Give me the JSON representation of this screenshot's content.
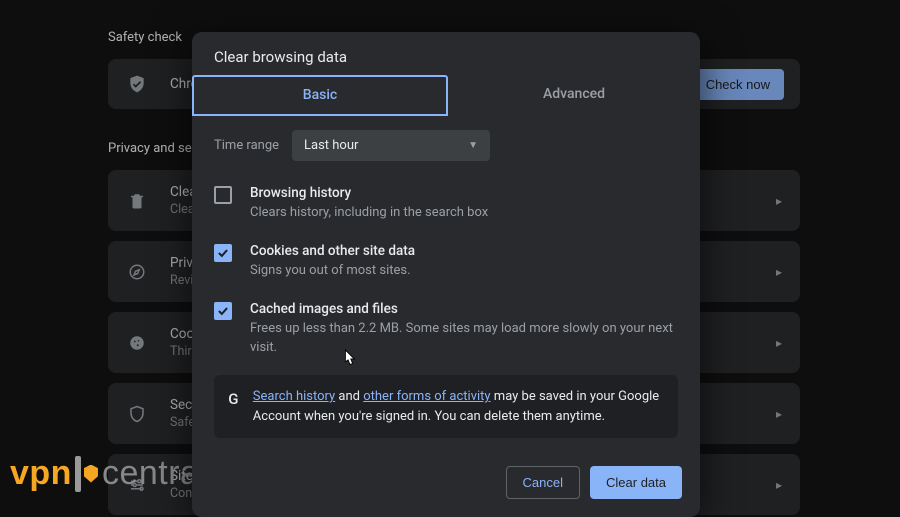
{
  "background": {
    "safety_check_title": "Safety check",
    "chrome_row_title": "Chrome",
    "check_now_label": "Check now",
    "privacy_title": "Privacy and security",
    "rows": [
      {
        "title": "Clear browsing data",
        "sub": "Clear history, cookies, cache, and more"
      },
      {
        "title": "Privacy Guide",
        "sub": "Review key privacy and security controls"
      },
      {
        "title": "Cookies and other site data",
        "sub": "Third-party cookies are blocked in Incognito mode"
      },
      {
        "title": "Security",
        "sub": "Safe Browsing (protection from dangerous sites) and other security settings"
      },
      {
        "title": "Site Settings",
        "sub": "Controls what information sites can use and show"
      }
    ]
  },
  "modal": {
    "title": "Clear browsing data",
    "tabs": {
      "basic": "Basic",
      "advanced": "Advanced"
    },
    "time_range_label": "Time range",
    "time_range_value": "Last hour",
    "options": [
      {
        "checked": false,
        "title": "Browsing history",
        "sub": "Clears history, including in the search box"
      },
      {
        "checked": true,
        "title": "Cookies and other site data",
        "sub": "Signs you out of most sites."
      },
      {
        "checked": true,
        "title": "Cached images and files",
        "sub": "Frees up less than 2.2 MB. Some sites may load more slowly on your next visit."
      }
    ],
    "info": {
      "link1": "Search history",
      "mid1": " and ",
      "link2": "other forms of activity",
      "rest": " may be saved in your Google Account when you're signed in. You can delete them anytime."
    },
    "actions": {
      "cancel": "Cancel",
      "clear": "Clear data"
    }
  },
  "watermark": {
    "vpn": "vpn",
    "central": "central"
  }
}
